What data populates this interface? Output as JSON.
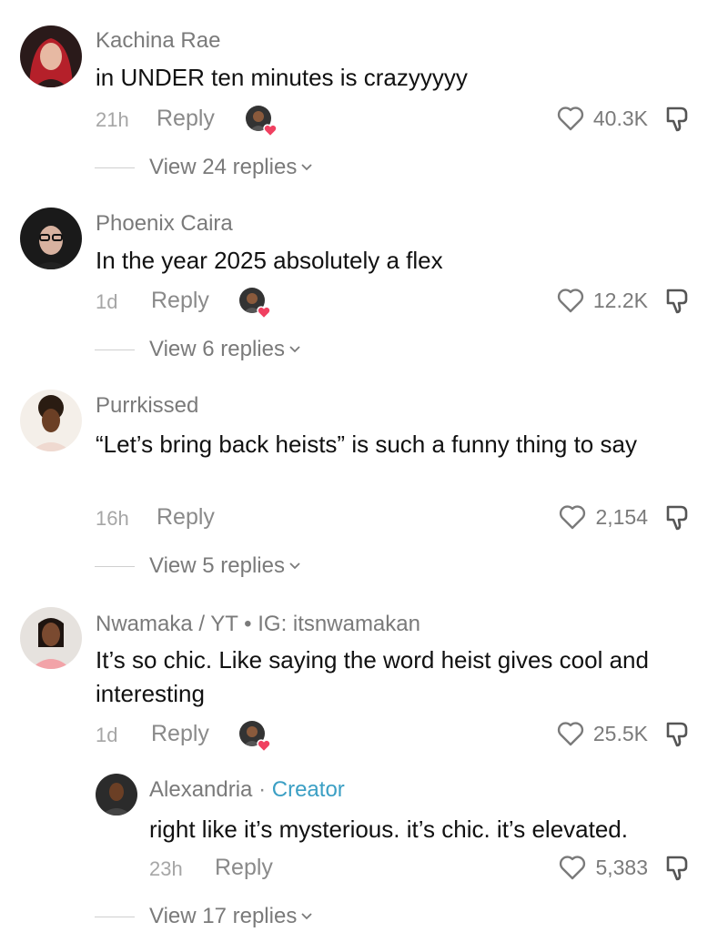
{
  "comments": [
    {
      "author": "Kachina Rae",
      "text": "in UNDER ten minutes is crazyyyyy",
      "time": "21h",
      "reply_label": "Reply",
      "likes": "40.3K",
      "view_replies": "View 24 replies",
      "avatar_icon": "avatar-red-hair"
    },
    {
      "author": "Phoenix Caira",
      "text": "In the year 2025 absolutely a flex",
      "time": "1d",
      "reply_label": "Reply",
      "likes": "12.2K",
      "view_replies": "View 6 replies",
      "avatar_icon": "avatar-glasses"
    },
    {
      "author": "Purrkissed",
      "text": "“Let’s bring back heists” is such a funny thing to say",
      "time": "16h",
      "reply_label": "Reply",
      "likes": "2,154",
      "view_replies": "View 5 replies",
      "avatar_icon": "avatar-curly-hair"
    },
    {
      "author": "Nwamaka / YT • IG: itsnwamakan",
      "text": "It’s so chic. Like saying the word heist gives cool and interesting",
      "time": "1d",
      "reply_label": "Reply",
      "likes": "25.5K",
      "avatar_icon": "avatar-pink-top"
    }
  ],
  "creator_reply": {
    "author": "Alexandria",
    "separator": "·",
    "badge": "Creator",
    "text": "right like it’s mysterious. it’s chic. it’s elevated.",
    "time": "23h",
    "reply_label": "Reply",
    "likes": "5,383",
    "view_replies": "View 17 replies"
  },
  "colors": {
    "creator_badge": "#3b9fc4",
    "liked_heart": "#f04060",
    "muted": "#7a7a7a"
  }
}
